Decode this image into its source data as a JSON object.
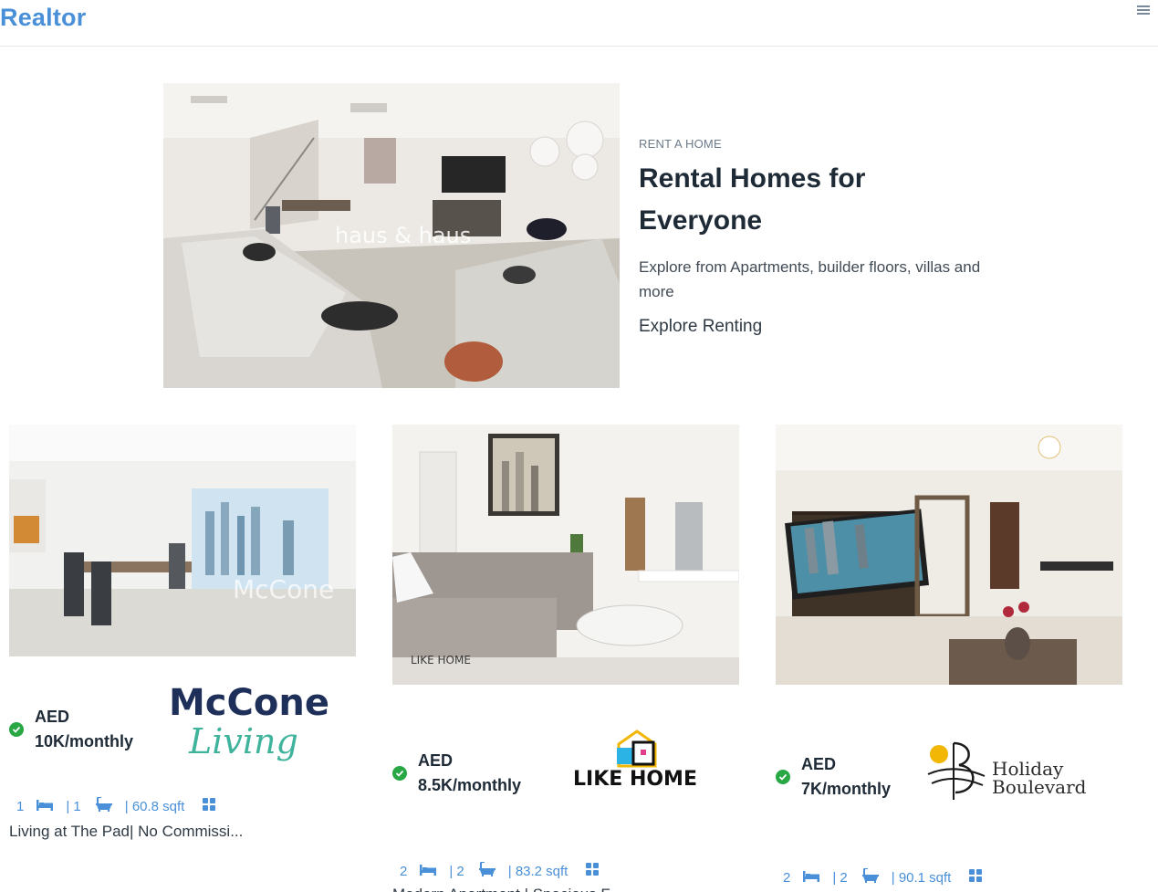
{
  "header": {
    "brand": "Realtor",
    "menu_icon": "hamburger-icon"
  },
  "hero": {
    "eyebrow": "RENT A HOME",
    "title": "Rental Homes for Everyone",
    "description": "Explore from Apartments, builder floors, villas and more",
    "cta": "Explore Renting",
    "image_watermark": "haus & haus"
  },
  "listings": [
    {
      "currency": "AED",
      "price": "10K/monthly",
      "beds": "1",
      "baths": "| 1",
      "area": "| 60.8 sqft",
      "title": "Living at The Pad| No Commissi...",
      "agency_logo": "McCone Living",
      "logo_line1": "McCone",
      "logo_line2": "Living"
    },
    {
      "currency": "AED",
      "price": "8.5K/monthly",
      "beds": "2",
      "baths": "| 2",
      "area": "| 83.2 sqft",
      "title": "Modern Apartment | Spacious F...",
      "agency_logo": "LIKE HOME",
      "logo_line1": "LIKE HOME",
      "watermark": "LIKE HOME"
    },
    {
      "currency": "AED",
      "price": "7K/monthly",
      "beds": "2",
      "baths": "| 2",
      "area": "| 90.1 sqft",
      "title": "",
      "agency_logo": "Holiday Boulevard",
      "logo_line1": "Holiday",
      "logo_line2": "Boulevard"
    }
  ],
  "icons": {
    "verified": "check-circle-icon",
    "bed": "bed-icon",
    "bath": "bathtub-icon",
    "grid": "grid-icon"
  },
  "colors": {
    "brand": "#4a90d9",
    "verified": "#28a745",
    "text_dark": "#1e2a36"
  }
}
